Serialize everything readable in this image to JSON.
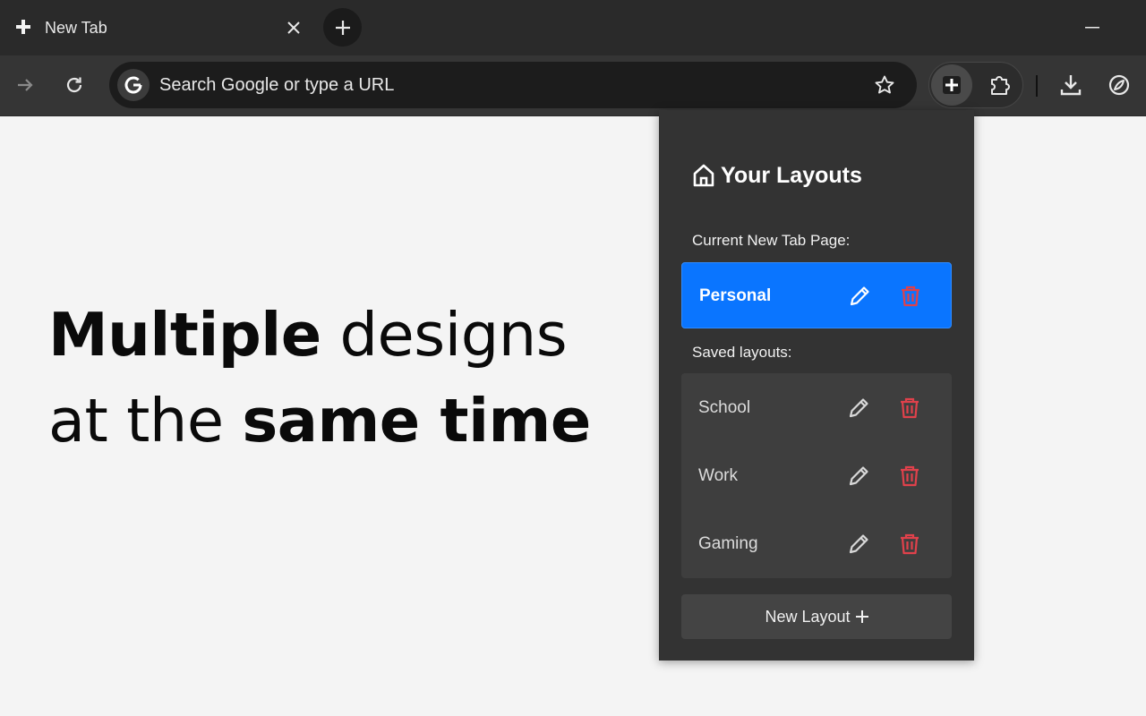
{
  "browser": {
    "tab": {
      "title": "New Tab"
    },
    "omnibox": {
      "placeholder": "Search Google or type a URL"
    }
  },
  "hero": {
    "line1_bold": "Multiple",
    "line1_light": " designs",
    "line2_light": "at the ",
    "line2_bold": "same time"
  },
  "popup": {
    "title": "Your Layouts",
    "current_label": "Current New Tab Page:",
    "current_layout": "Personal",
    "saved_label": "Saved layouts:",
    "saved_layouts": [
      "School",
      "Work",
      "Gaming"
    ],
    "new_layout_label": "New Layout"
  },
  "colors": {
    "accent_blue": "#0a75ff",
    "delete_red": "#e0414b",
    "toolbar_bg": "#353535",
    "tabstrip_bg": "#2a2a2a",
    "popup_bg": "#333333"
  }
}
